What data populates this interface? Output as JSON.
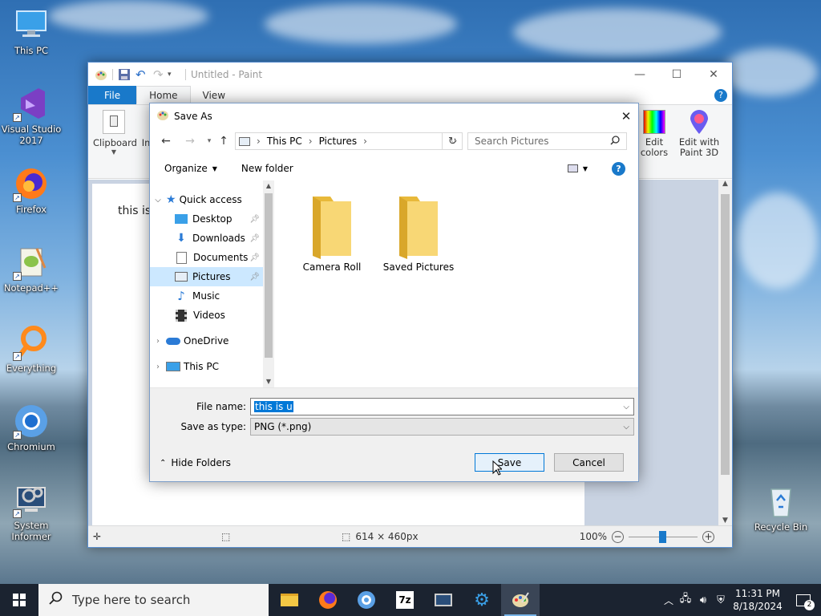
{
  "desktop": {
    "icons": [
      {
        "label": "This PC",
        "icon": "monitor-icon"
      },
      {
        "label": "Visual Studio 2017",
        "icon": "visual-studio-icon"
      },
      {
        "label": "Firefox",
        "icon": "firefox-icon"
      },
      {
        "label": "Notepad++",
        "icon": "notepadpp-icon"
      },
      {
        "label": "Everything",
        "icon": "search-magnifier-icon"
      },
      {
        "label": "Chromium",
        "icon": "chromium-icon"
      },
      {
        "label": "System Informer",
        "icon": "system-informer-icon"
      },
      {
        "label": "Recycle Bin",
        "icon": "recycle-bin-icon"
      }
    ]
  },
  "paint": {
    "title": "Untitled - Paint",
    "tabs": [
      "File",
      "Home",
      "View"
    ],
    "ribbon": {
      "clipboard": "Clipboard",
      "image_partial": "Im",
      "edit_colors": "Edit colors",
      "edit_with_paint3d": "Edit with Paint 3D"
    },
    "canvas_text": "this is",
    "status": {
      "dimensions": "614 × 460px",
      "zoom": "100%"
    }
  },
  "dialog": {
    "title": "Save As",
    "breadcrumb": [
      "This PC",
      "Pictures"
    ],
    "search_placeholder": "Search Pictures",
    "organize": "Organize",
    "new_folder": "New folder",
    "nav": {
      "quick_access": "Quick access",
      "items": [
        "Desktop",
        "Downloads",
        "Documents",
        "Pictures",
        "Music",
        "Videos"
      ],
      "onedrive": "OneDrive",
      "this_pc": "This PC"
    },
    "folders": [
      "Camera Roll",
      "Saved Pictures"
    ],
    "file_name_label": "File name:",
    "file_name_value": "this is u",
    "save_type_label": "Save as type:",
    "save_type_value": "PNG (*.png)",
    "hide_folders": "Hide Folders",
    "save": "Save",
    "cancel": "Cancel"
  },
  "taskbar": {
    "search_placeholder": "Type here to search",
    "time": "11:31 PM",
    "date": "8/18/2024",
    "notifications": "2"
  }
}
